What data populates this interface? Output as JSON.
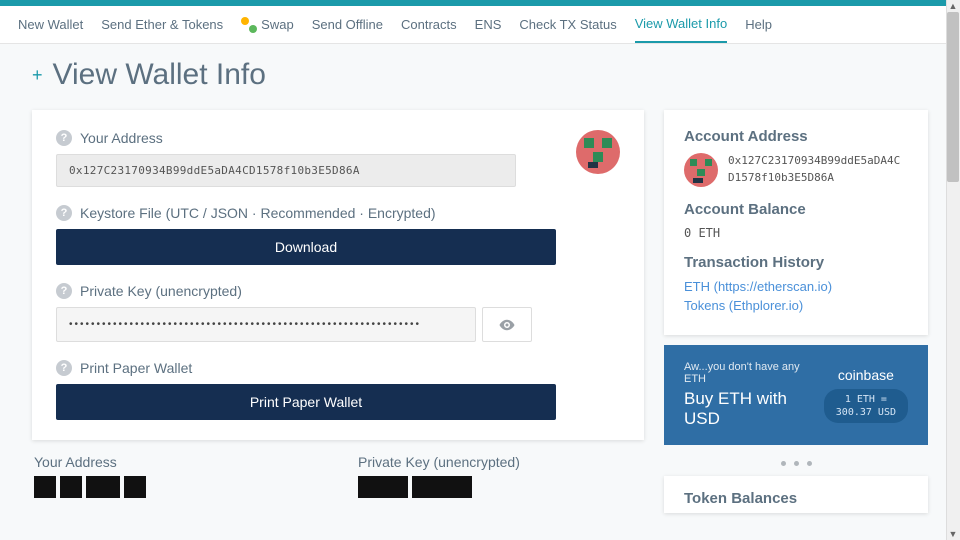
{
  "nav": {
    "items": [
      "New Wallet",
      "Send Ether & Tokens",
      "Swap",
      "Send Offline",
      "Contracts",
      "ENS",
      "Check TX Status",
      "View Wallet Info",
      "Help"
    ],
    "active_index": 7
  },
  "page_title": "View Wallet Info",
  "address": "0x127C23170934B99ddE5aDA4CD1578f10b3E5D86A",
  "sections": {
    "address_label": "Your Address",
    "keystore_label": "Keystore File (UTC / JSON · Recommended · Encrypted)",
    "download_btn": "Download",
    "pk_label": "Private Key (unencrypted)",
    "pk_mask": "••••••••••••••••••••••••••••••••••••••••••••••••••••••••••••••••",
    "paper_label": "Print Paper Wallet",
    "paper_btn": "Print Paper Wallet"
  },
  "account": {
    "addr_title": "Account Address",
    "addr_value_line1": "0x127C23170934B99ddE5aDA4C",
    "addr_value_line2": "D1578f10b3E5D86A",
    "bal_title": "Account Balance",
    "bal_value": "0 ETH",
    "hist_title": "Transaction History",
    "hist_links": [
      "ETH (https://etherscan.io)",
      "Tokens (Ethplorer.io)"
    ]
  },
  "promo": {
    "subtext": "Aw...you don't have any ETH",
    "headline": "Buy ETH with USD",
    "brand": "coinbase",
    "rate_line1": "1 ETH =",
    "rate_line2": "300.37 USD"
  },
  "qr": {
    "addr_label": "Your Address",
    "pk_label": "Private Key (unencrypted)"
  },
  "tokens": {
    "title": "Token Balances"
  }
}
